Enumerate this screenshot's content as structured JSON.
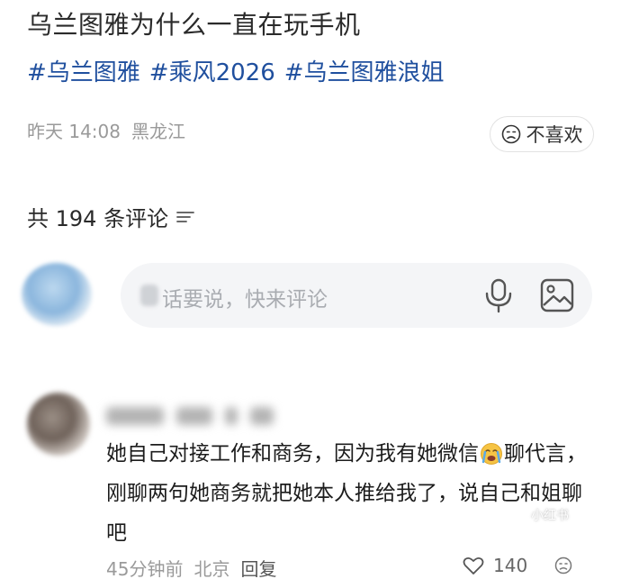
{
  "post": {
    "title": "乌兰图雅为什么一直在玩手机",
    "tags": [
      "#乌兰图雅",
      "#乘风2026",
      "#乌兰图雅浪姐"
    ],
    "time": "昨天 14:08",
    "location": "黑龙江",
    "dislike_label": "不喜欢"
  },
  "comments_header": {
    "count_text": "共 194 条评论"
  },
  "input": {
    "placeholder": "话要说，快来评论"
  },
  "comment": {
    "text_part1": "她自己对接工作和商务，因为我有她微信",
    "text_part2": "聊代言，刚聊两句她商务就把她本人推给我了，说自己和姐聊吧",
    "time": "45分钟前",
    "location": "北京",
    "reply_label": "回复",
    "likes": "140",
    "watermark": "小红书"
  },
  "icons": {
    "dislike": "sad-face-icon",
    "sort": "sort-lines-icon",
    "mic": "microphone-icon",
    "image": "image-icon",
    "emoji": "crying-face-emoji",
    "like": "heart-icon"
  }
}
